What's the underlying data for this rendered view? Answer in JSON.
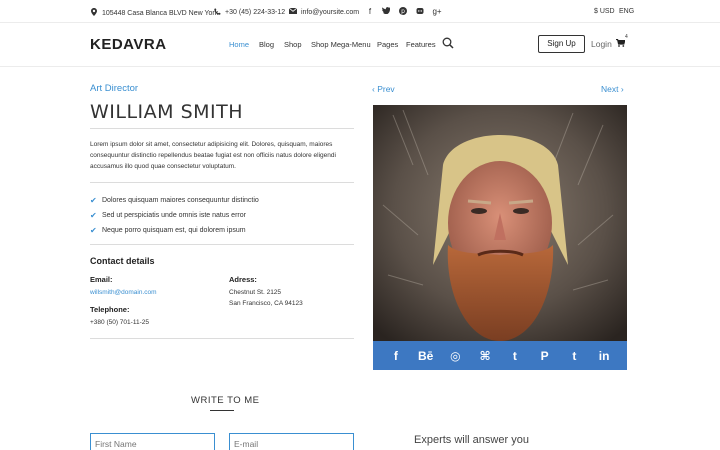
{
  "topbar": {
    "address": "105448 Casa Blanca BLVD New York",
    "phone": "+30 (45) 224-33-12",
    "email": "info@yoursite.com",
    "social_icons": [
      "facebook-icon",
      "twitter-icon",
      "pinterest-icon",
      "github-icon",
      "google-plus-icon"
    ],
    "currency": "$ USD",
    "language": "ENG"
  },
  "header": {
    "logo": "KEDAVRA",
    "nav": [
      "Home",
      "Blog",
      "Shop",
      "Shop Mega-Menu",
      "Pages",
      "Features"
    ],
    "active_nav": "Home",
    "signup": "Sign Up",
    "login": "Login",
    "cart_count": "4"
  },
  "profile": {
    "role": "Art Director",
    "name": "WILLIAM SMITH",
    "intro": "Lorem ipsum dolor sit amet, consectetur adipisicing elit. Dolores, quisquam, maiores consequuntur distinctio repellendus beatae fugiat est non officiis natus dolore eligendi accusamus illo quod quae consectetur voluptatum.",
    "checklist": [
      "Dolores quisquam maiores consequuntur distinctio",
      "Sed ut perspiciatis unde omnis iste natus error",
      "Neque porro quisquam est, qui dolorem ipsum"
    ],
    "contact_title": "Contact details",
    "email_label": "Email:",
    "email": "willsmith@domain.com",
    "telephone_label": "Telephone:",
    "telephone": "+380 (50) 701-11-25",
    "address_label": "Adress:",
    "address_line1": "Chestnut St. 2125",
    "address_line2": "San Francisco, CA 94123"
  },
  "pager": {
    "prev": "Prev",
    "next": "Next"
  },
  "social": {
    "labels": [
      "f",
      "Bē",
      "◎",
      "⌘",
      "t",
      "P",
      "t",
      "in"
    ],
    "icons": [
      "facebook-icon",
      "behance-icon",
      "dribbble-icon",
      "github-icon",
      "twitter-icon",
      "pinterest-icon",
      "tumblr-icon",
      "linkedin-icon"
    ]
  },
  "form": {
    "title": "WRITE TO ME",
    "first_name_placeholder": "First Name",
    "email_placeholder": "E-mail"
  },
  "experts": "Experts will answer you",
  "colors": {
    "accent": "#3a8fd1",
    "social_strip": "#3d78c2"
  }
}
